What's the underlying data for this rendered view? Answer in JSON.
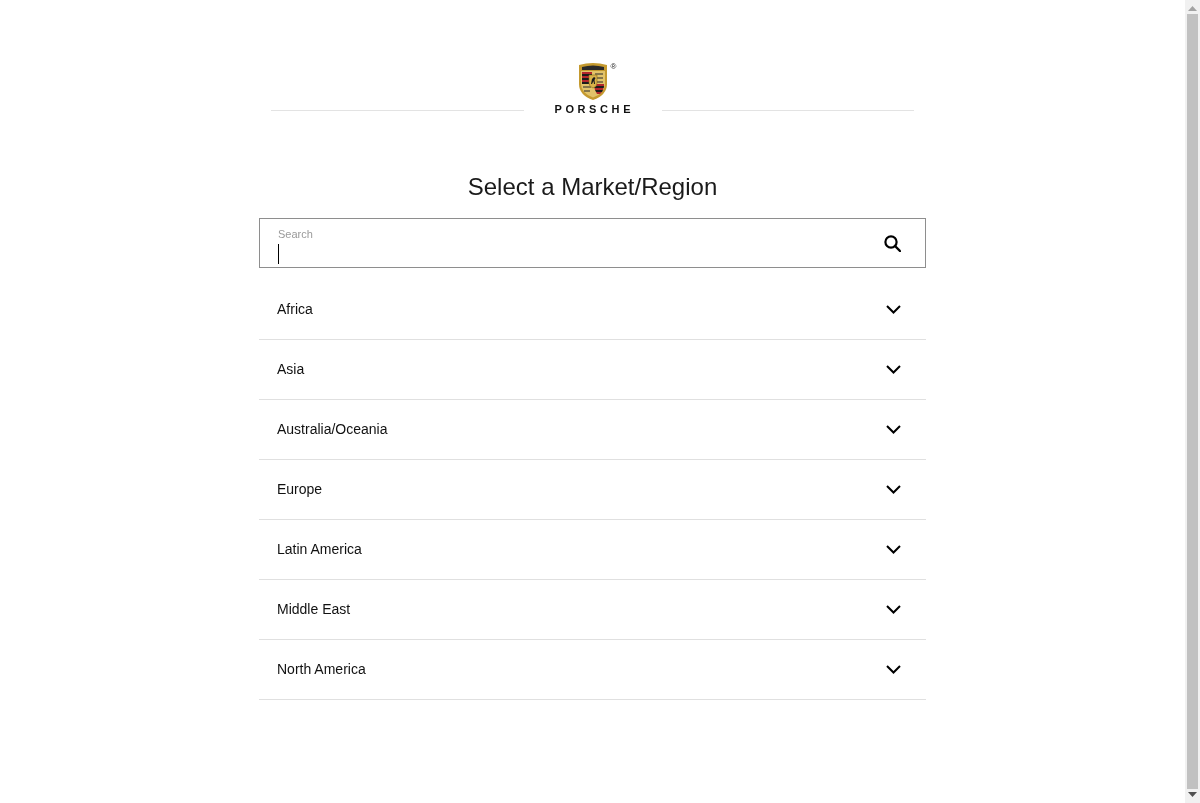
{
  "logo": {
    "trademark": "®",
    "wordmark": "PORSCHE"
  },
  "title": "Select a Market/Region",
  "search": {
    "label": "Search",
    "focused": true
  },
  "regions": [
    {
      "name": "Africa",
      "expanded": false
    },
    {
      "name": "Asia",
      "expanded": false
    },
    {
      "name": "Australia/Oceania",
      "expanded": false
    },
    {
      "name": "Europe",
      "expanded": false
    },
    {
      "name": "Latin America",
      "expanded": false
    },
    {
      "name": "Middle East",
      "expanded": false
    },
    {
      "name": "North America",
      "expanded": false
    }
  ]
}
